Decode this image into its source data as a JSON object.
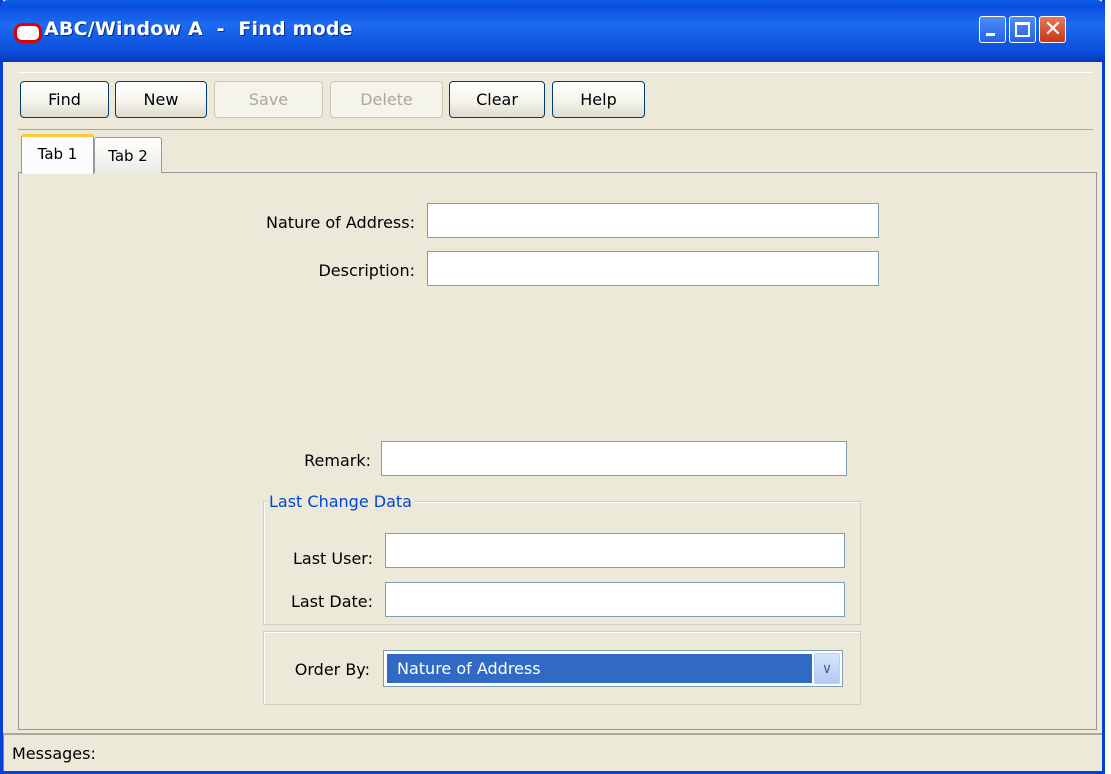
{
  "window": {
    "title": "ABC/Window A  -  Find mode",
    "logo_icon": "oracle-logo-icon",
    "controls": {
      "minimize_icon": "minimize-icon",
      "maximize_icon": "maximize-icon",
      "close_icon": "close-icon",
      "close_glyph": "✕"
    }
  },
  "toolbar": {
    "find_label": "Find",
    "new_label": "New",
    "save_label": "Save",
    "delete_label": "Delete",
    "clear_label": "Clear",
    "help_label": "Help"
  },
  "tabs": [
    {
      "label": "Tab 1",
      "active": true
    },
    {
      "label": "Tab 2",
      "active": false
    }
  ],
  "form": {
    "nature_of_address": {
      "label": "Nature of Address:",
      "value": ""
    },
    "description": {
      "label": "Description:",
      "value": ""
    },
    "remark": {
      "label": "Remark:",
      "value": ""
    },
    "last_change_group": {
      "legend": "Last Change Data",
      "last_user": {
        "label": "Last User:",
        "value": ""
      },
      "last_date": {
        "label": "Last Date:",
        "value": ""
      }
    },
    "order_by": {
      "label": "Order By:",
      "selected": "Nature of Address",
      "arrow_icon": "chevron-down-icon"
    }
  },
  "status": {
    "messages_label": "Messages:"
  },
  "colors": {
    "title_bar": "#0a4fe0",
    "selection": "#316ac5",
    "legend": "#0046d5",
    "tab_highlight": "#ffc83c"
  }
}
